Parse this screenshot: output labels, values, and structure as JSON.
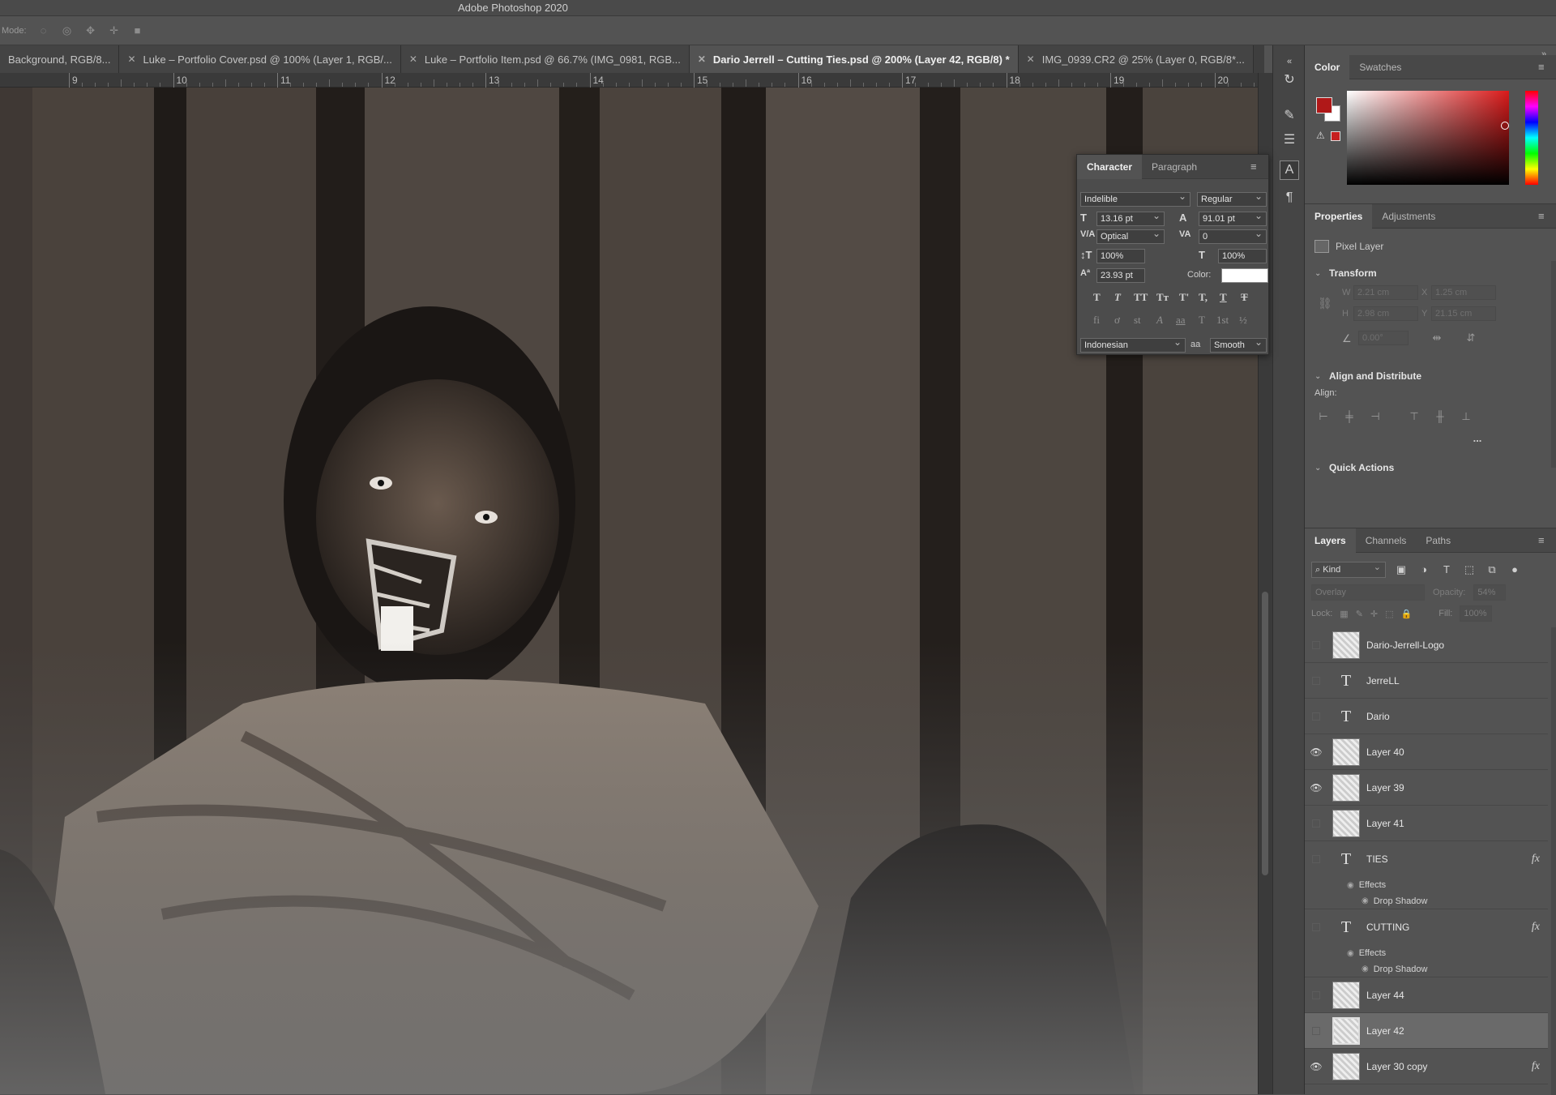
{
  "app": {
    "title": "Adobe Photoshop 2020"
  },
  "options_bar": {
    "mode_label": "Mode:"
  },
  "tabs": [
    {
      "label": "Background, RGB/8...",
      "active": false
    },
    {
      "label": "Luke – Portfolio Cover.psd @ 100% (Layer 1, RGB/...",
      "active": false
    },
    {
      "label": "Luke – Portfolio Item.psd @ 66.7% (IMG_0981, RGB...",
      "active": false
    },
    {
      "label": "Dario Jerrell – Cutting Ties.psd @ 200% (Layer 42, RGB/8) *",
      "active": true
    },
    {
      "label": "IMG_0939.CR2 @ 25% (Layer 0, RGB/8*...",
      "active": false
    }
  ],
  "ruler": {
    "ticks": [
      "9",
      "10",
      "11",
      "12",
      "13",
      "14",
      "15",
      "16",
      "17",
      "18",
      "19",
      "20"
    ]
  },
  "color_panel": {
    "tab_color": "Color",
    "tab_swatches": "Swatches",
    "foreground": "#b01818",
    "background": "#ffffff"
  },
  "properties_panel": {
    "tab_properties": "Properties",
    "tab_adjustments": "Adjustments",
    "layer_type": "Pixel Layer",
    "transform_label": "Transform",
    "w_label": "W",
    "w_value": "2.21 cm",
    "h_label": "H",
    "h_value": "2.98 cm",
    "x_label": "X",
    "x_value": "1.25 cm",
    "y_label": "Y",
    "y_value": "21.15 cm",
    "angle_value": "0.00°",
    "align_section": "Align and Distribute",
    "align_label": "Align:",
    "more": "...",
    "quick_actions": "Quick Actions"
  },
  "character_panel": {
    "tab_character": "Character",
    "tab_paragraph": "Paragraph",
    "font_family": "Indelible",
    "font_style": "Regular",
    "font_size": "13.16 pt",
    "leading": "91.01 pt",
    "kerning": "Optical",
    "tracking": "0",
    "vertical_scale": "100%",
    "horizontal_scale": "100%",
    "baseline_shift": "23.93 pt",
    "color_label": "Color:",
    "language": "Indonesian",
    "antialias_label": "a",
    "antialias": "Smooth",
    "antialias_icon": "aa-icon",
    "type_buttons": [
      "T",
      "T",
      "TT",
      "Tт",
      "T'",
      "T,",
      "T",
      "T"
    ],
    "opentype_buttons": [
      "fi",
      "ơ",
      "st",
      "A",
      "aa",
      "T",
      "1st",
      "½"
    ]
  },
  "layers_panel": {
    "tab_layers": "Layers",
    "tab_channels": "Channels",
    "tab_paths": "Paths",
    "filter_kind": "Kind",
    "blend_mode": "Overlay",
    "opacity_label": "Opacity:",
    "opacity_value": "54%",
    "lock_label": "Lock:",
    "fill_label": "Fill:",
    "fill_value": "100%",
    "effects_label": "Effects",
    "drop_shadow_label": "Drop Shadow",
    "layers": [
      {
        "name": "Dario-Jerrell-Logo",
        "kind": "pixel",
        "visible": false
      },
      {
        "name": "JerreLL",
        "kind": "text",
        "visible": false
      },
      {
        "name": "Dario",
        "kind": "text",
        "visible": false
      },
      {
        "name": "Layer 40",
        "kind": "pixel",
        "visible": true
      },
      {
        "name": "Layer 39",
        "kind": "pixel",
        "visible": true
      },
      {
        "name": "Layer 41",
        "kind": "pixel",
        "visible": false
      },
      {
        "name": "TIES",
        "kind": "text",
        "visible": false,
        "fx": true
      },
      {
        "name": "CUTTING",
        "kind": "text",
        "visible": false,
        "fx": true
      },
      {
        "name": "Layer 44",
        "kind": "pixel",
        "visible": false
      },
      {
        "name": "Layer 42",
        "kind": "pixel",
        "visible": false,
        "selected": true
      },
      {
        "name": "Layer 30 copy",
        "kind": "pixel",
        "visible": true,
        "fx": true
      }
    ],
    "fx_label": "fx"
  }
}
